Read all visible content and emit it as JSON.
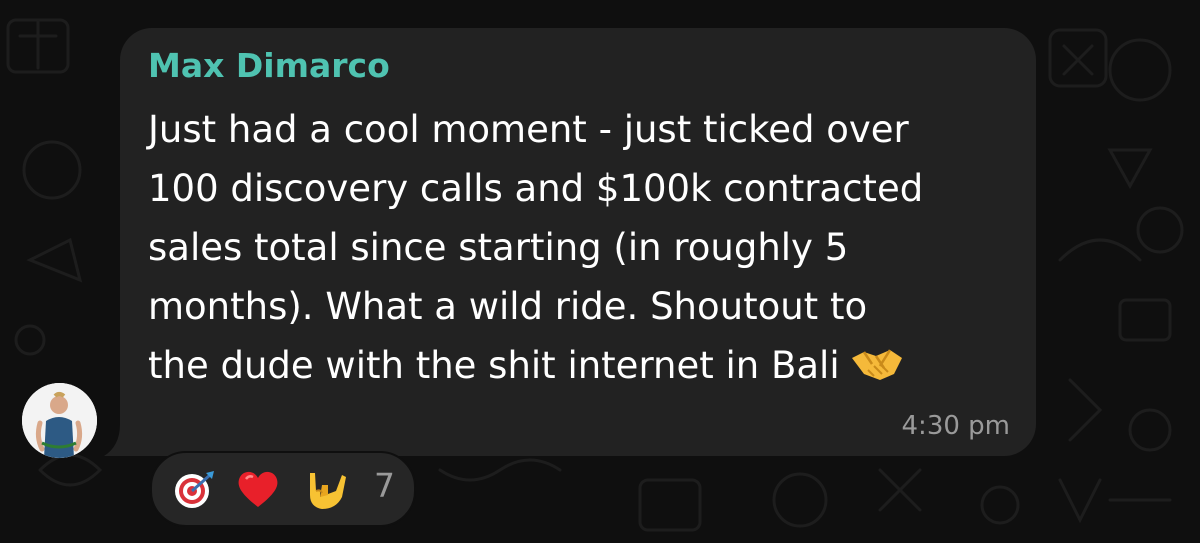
{
  "message": {
    "sender": "Max Dimarco",
    "lines": [
      "Just had a cool moment - just ticked over",
      "100 discovery calls and $100k contracted",
      "sales total since starting (in roughly 5",
      "months). What a wild ride. Shoutout to",
      "the dude with the shit internet in Bali"
    ],
    "timestamp": "4:30 pm"
  },
  "reactions": {
    "items": [
      {
        "icon": "dart-target-icon"
      },
      {
        "icon": "red-heart-icon"
      },
      {
        "icon": "love-you-gesture-icon"
      }
    ],
    "count": "7"
  },
  "colors": {
    "background": "#0f0f0f",
    "bubble": "#222222",
    "sender_name": "#4fc3b1",
    "message_text": "#ffffff",
    "timestamp": "#9a9a9a"
  }
}
